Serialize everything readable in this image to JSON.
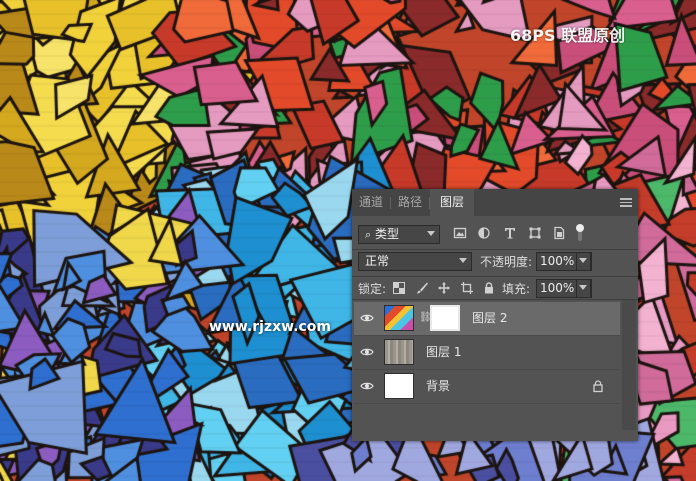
{
  "watermark": {
    "logo": "68PS 联盟原创",
    "url": "www.rjzxw.com"
  },
  "panel": {
    "tabs": [
      {
        "label": "通道",
        "active": false
      },
      {
        "label": "路径",
        "active": false
      },
      {
        "label": "图层",
        "active": true
      }
    ],
    "filter": {
      "kind_label": "类型",
      "icons": [
        "image-filter-icon",
        "adjustment-filter-icon",
        "type-filter-icon",
        "shape-filter-icon",
        "smart-object-filter-icon",
        "filter-toggle-icon"
      ]
    },
    "blend_mode": "正常",
    "opacity_label": "不透明度:",
    "opacity_value": "100%",
    "lock_label": "锁定:",
    "fill_label": "填充:",
    "fill_value": "100%",
    "layers": [
      {
        "name": "图层 2",
        "selected": true,
        "thumb": "graffiti",
        "has_mask": true,
        "locked": false
      },
      {
        "name": "图层 1",
        "selected": false,
        "thumb": "concrete",
        "has_mask": false,
        "locked": false
      },
      {
        "name": "背景",
        "selected": false,
        "thumb": "white",
        "has_mask": false,
        "locked": true
      }
    ]
  },
  "colors": {
    "panel_bg": "#535353",
    "tab_bar": "#454545",
    "selected_row": "#6a6a6a"
  }
}
